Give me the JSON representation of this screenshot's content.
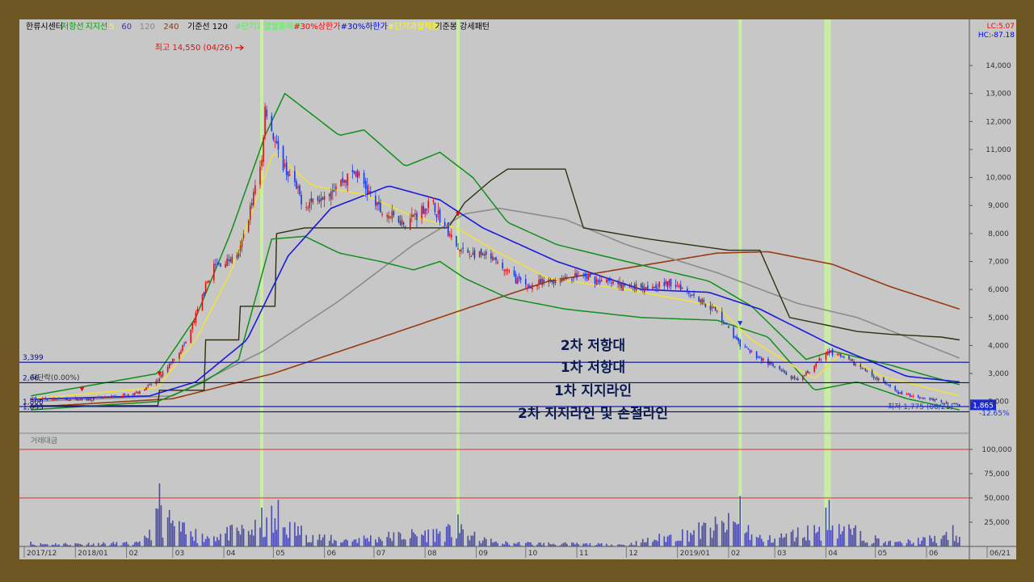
{
  "header": {
    "items": [
      {
        "text": "한류시센터",
        "color": "#000000"
      },
      {
        "text": "저항선",
        "color": "#00a000"
      },
      {
        "text": "지지선",
        "color": "#00a000"
      },
      {
        "text": "5",
        "color": "#ffff00"
      },
      {
        "text": "60",
        "color": "#3333cc"
      },
      {
        "text": "120",
        "color": "#888888"
      },
      {
        "text": "240",
        "color": "#8b3a0f"
      },
      {
        "text": "기준선 120",
        "color": "#000000"
      },
      {
        "text": "#단기과열발동예고",
        "color": "#40ff40"
      },
      {
        "text": "#30%상한가",
        "color": "#ff0000"
      },
      {
        "text": "#30%하한가",
        "color": "#0000ff"
      },
      {
        "text": "#단기과열적용",
        "color": "#ffff00"
      },
      {
        "text": "기준봉 강세패턴",
        "color": "#000000"
      }
    ],
    "right_top": "LC:5.07",
    "right_bottom": "HC:-87.18"
  },
  "volume_label": "거래대금",
  "annotations": {
    "high": "최고 14,550 (04/26)",
    "low": "최저 1,775 (06/21)",
    "flat_label": "저단락(0.00%)",
    "last_change": "-12.65%",
    "current_price": "1,865"
  },
  "level_lines": [
    {
      "value": 3399,
      "label": "2차 저항대",
      "tag": "3,399"
    },
    {
      "value": 2670,
      "label": "1차 저항대",
      "tag": "2,66"
    },
    {
      "value": 1820,
      "label": "1차 지지라인",
      "tag": "1,800"
    },
    {
      "value": 1633,
      "label": "2차 지지라인 및 손절라인",
      "tag": "1,633"
    }
  ],
  "chart_data": {
    "type": "candlestick",
    "xlabels": [
      "2017/12",
      "2018/01",
      "02",
      "03",
      "04",
      "05",
      "06",
      "07",
      "08",
      "09",
      "10",
      "11",
      "12",
      "2019/01",
      "02",
      "03",
      "04",
      "05",
      "06",
      "06/21"
    ],
    "price_axis": {
      "ticks": [
        "14,000",
        "13,000",
        "12,000",
        "11,000",
        "10,000",
        "9,000",
        "8,000",
        "7,000",
        "6,000",
        "5,000",
        "4,000",
        "3,000",
        "2,000"
      ],
      "ylim": [
        1500,
        15300
      ]
    },
    "volume_axis": {
      "ticks": [
        "100,000",
        "75,000",
        "50,000",
        "25,000"
      ],
      "ylim": [
        0,
        110000
      ]
    },
    "highlights": [
      "2018/04/24",
      "2018/08/21",
      "2019/02/08",
      "2019/04/01",
      "2019/04/03"
    ],
    "price_keys": [
      [
        "2017-12-05",
        2100
      ],
      [
        "2018-01-10",
        2080
      ],
      [
        "2018-02-05",
        2250
      ],
      [
        "2018-02-20",
        2750
      ],
      [
        "2018-03-10",
        4200
      ],
      [
        "2018-03-25",
        6800
      ],
      [
        "2018-04-10",
        7200
      ],
      [
        "2018-04-24",
        10600
      ],
      [
        "2018-04-26",
        12600
      ],
      [
        "2018-05-04",
        10800
      ],
      [
        "2018-05-20",
        9000
      ],
      [
        "2018-06-05",
        9600
      ],
      [
        "2018-06-20",
        10200
      ],
      [
        "2018-07-05",
        8800
      ],
      [
        "2018-07-20",
        8400
      ],
      [
        "2018-08-05",
        9100
      ],
      [
        "2018-08-21",
        7400
      ],
      [
        "2018-09-10",
        7100
      ],
      [
        "2018-10-01",
        6100
      ],
      [
        "2018-11-01",
        6500
      ],
      [
        "2018-12-01",
        6100
      ],
      [
        "2019-01-01",
        6200
      ],
      [
        "2019-01-25",
        5200
      ],
      [
        "2019-02-08",
        4000
      ],
      [
        "2019-03-15",
        2700
      ],
      [
        "2019-04-03",
        3800
      ],
      [
        "2019-04-20",
        3300
      ],
      [
        "2019-05-15",
        2300
      ],
      [
        "2019-06-21",
        1870
      ]
    ],
    "ma5": [
      [
        "2017-12-05",
        2100
      ],
      [
        "2018-02-20",
        2500
      ],
      [
        "2018-03-15",
        4200
      ],
      [
        "2018-04-05",
        6600
      ],
      [
        "2018-05-01",
        10900
      ],
      [
        "2018-05-25",
        9700
      ],
      [
        "2018-06-25",
        9400
      ],
      [
        "2018-07-25",
        8600
      ],
      [
        "2018-08-20",
        8200
      ],
      [
        "2018-09-15",
        7300
      ],
      [
        "2018-10-15",
        6400
      ],
      [
        "2018-12-01",
        6000
      ],
      [
        "2019-01-25",
        5400
      ],
      [
        "2019-02-15",
        4200
      ],
      [
        "2019-03-25",
        2800
      ],
      [
        "2019-04-10",
        3700
      ],
      [
        "2019-05-05",
        2900
      ],
      [
        "2019-06-21",
        2200
      ]
    ],
    "ma60": [
      [
        "2017-12-05",
        2080
      ],
      [
        "2018-02-15",
        2200
      ],
      [
        "2018-03-15",
        2700
      ],
      [
        "2018-04-15",
        4200
      ],
      [
        "2018-05-10",
        7200
      ],
      [
        "2018-06-05",
        8900
      ],
      [
        "2018-07-10",
        9700
      ],
      [
        "2018-08-10",
        9200
      ],
      [
        "2018-09-05",
        8200
      ],
      [
        "2018-10-20",
        7000
      ],
      [
        "2018-12-10",
        6000
      ],
      [
        "2019-01-20",
        5900
      ],
      [
        "2019-02-20",
        5300
      ],
      [
        "2019-04-05",
        4000
      ],
      [
        "2019-05-20",
        2900
      ],
      [
        "2019-06-21",
        2700
      ]
    ],
    "ma120": [
      [
        "2017-12-05",
        2000
      ],
      [
        "2018-03-01",
        2200
      ],
      [
        "2018-04-25",
        3800
      ],
      [
        "2018-06-10",
        5600
      ],
      [
        "2018-07-25",
        7600
      ],
      [
        "2018-08-25",
        8700
      ],
      [
        "2018-09-15",
        8900
      ],
      [
        "2018-10-25",
        8500
      ],
      [
        "2018-12-01",
        7600
      ],
      [
        "2019-01-25",
        6600
      ],
      [
        "2019-03-15",
        5500
      ],
      [
        "2019-04-20",
        5000
      ],
      [
        "2019-06-21",
        3550
      ]
    ],
    "ma240": [
      [
        "2017-12-05",
        1800
      ],
      [
        "2018-03-01",
        2100
      ],
      [
        "2018-05-01",
        3000
      ],
      [
        "2018-07-01",
        4200
      ],
      [
        "2018-08-25",
        5300
      ],
      [
        "2018-10-15",
        6300
      ],
      [
        "2018-12-15",
        6900
      ],
      [
        "2019-01-25",
        7300
      ],
      [
        "2019-02-25",
        7350
      ],
      [
        "2019-04-05",
        6900
      ],
      [
        "2019-05-10",
        6100
      ],
      [
        "2019-06-21",
        5300
      ]
    ],
    "baseline120": [
      [
        "2017-12-05",
        1850
      ],
      [
        "2018-02-20",
        1850
      ],
      [
        "2018-02-21",
        2400
      ],
      [
        "2018-03-20",
        2400
      ],
      [
        "2018-03-21",
        4200
      ],
      [
        "2018-04-10",
        4200
      ],
      [
        "2018-04-11",
        5400
      ],
      [
        "2018-05-02",
        5400
      ],
      [
        "2018-05-03",
        8000
      ],
      [
        "2018-05-20",
        8200
      ],
      [
        "2018-08-15",
        8200
      ],
      [
        "2018-08-25",
        9100
      ],
      [
        "2018-09-10",
        9900
      ],
      [
        "2018-09-20",
        10300
      ],
      [
        "2018-10-25",
        10300
      ],
      [
        "2018-11-05",
        8200
      ],
      [
        "2018-11-25",
        8000
      ],
      [
        "2018-12-15",
        7800
      ],
      [
        "2019-02-01",
        7400
      ],
      [
        "2019-02-20",
        7400
      ],
      [
        "2019-03-10",
        5000
      ],
      [
        "2019-04-20",
        4500
      ],
      [
        "2019-05-10",
        4400
      ],
      [
        "2019-06-10",
        4300
      ],
      [
        "2019-06-21",
        4200
      ]
    ],
    "resist": [
      [
        "2017-12-05",
        2200
      ],
      [
        "2018-02-20",
        3000
      ],
      [
        "2018-03-15",
        5000
      ],
      [
        "2018-04-05",
        8000
      ],
      [
        "2018-04-26",
        11500
      ],
      [
        "2018-05-08",
        13000
      ],
      [
        "2018-06-10",
        11500
      ],
      [
        "2018-06-25",
        11700
      ],
      [
        "2018-07-20",
        10400
      ],
      [
        "2018-08-10",
        10900
      ],
      [
        "2018-08-30",
        10000
      ],
      [
        "2018-09-20",
        8400
      ],
      [
        "2018-10-20",
        7600
      ],
      [
        "2018-12-01",
        7000
      ],
      [
        "2019-01-20",
        6300
      ],
      [
        "2019-02-15",
        5400
      ],
      [
        "2019-03-20",
        3500
      ],
      [
        "2019-04-05",
        3800
      ],
      [
        "2019-05-10",
        3300
      ],
      [
        "2019-06-21",
        2600
      ]
    ],
    "support": [
      [
        "2017-12-05",
        1700
      ],
      [
        "2018-02-20",
        2000
      ],
      [
        "2018-03-20",
        2700
      ],
      [
        "2018-04-10",
        3500
      ],
      [
        "2018-04-30",
        7800
      ],
      [
        "2018-05-20",
        7900
      ],
      [
        "2018-06-10",
        7300
      ],
      [
        "2018-07-05",
        7000
      ],
      [
        "2018-07-25",
        6700
      ],
      [
        "2018-08-10",
        7000
      ],
      [
        "2018-08-25",
        6400
      ],
      [
        "2018-09-20",
        5700
      ],
      [
        "2018-10-25",
        5300
      ],
      [
        "2018-12-10",
        5000
      ],
      [
        "2019-01-25",
        4900
      ],
      [
        "2019-02-25",
        4300
      ],
      [
        "2019-03-25",
        2400
      ],
      [
        "2019-04-20",
        2700
      ],
      [
        "2019-05-20",
        2100
      ],
      [
        "2019-06-21",
        1700
      ]
    ],
    "volume_keys": [
      [
        "2017-12-05",
        5000
      ],
      [
        "2018-02-10",
        7000
      ],
      [
        "2018-02-21",
        65000
      ],
      [
        "2018-03-15",
        18000
      ],
      [
        "2018-04-24",
        40000
      ],
      [
        "2018-04-30",
        42000
      ],
      [
        "2018-05-04",
        48000
      ],
      [
        "2018-06-05",
        12000
      ],
      [
        "2018-08-21",
        33000
      ],
      [
        "2018-09-10",
        8000
      ],
      [
        "2018-12-01",
        4000
      ],
      [
        "2019-02-08",
        52000
      ],
      [
        "2019-02-20",
        12000
      ],
      [
        "2019-04-01",
        40000
      ],
      [
        "2019-04-03",
        48000
      ],
      [
        "2019-05-10",
        6000
      ],
      [
        "2019-06-17",
        22000
      ],
      [
        "2019-06-21",
        10000
      ]
    ]
  }
}
